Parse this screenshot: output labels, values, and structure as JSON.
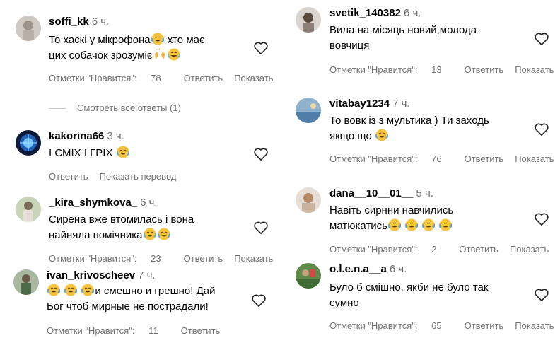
{
  "labels": {
    "likes_prefix": "Отметки \"Нравится\": ",
    "reply": "Ответить",
    "show": "Показать",
    "show_translation": "Показать перевод",
    "view_all_replies": "Смотреть все ответы (1)"
  },
  "comments_left": [
    {
      "user": "soffi_kk",
      "time": "6 ч.",
      "line1": "То хаскі у мікрофона",
      "line1_emoji": "laugh-cry",
      "line1_after": " хто має",
      "line2": "цих собачок зрозуміє",
      "line2_emojis": [
        "raised-hands",
        "laugh-cry"
      ],
      "likes": "78"
    },
    {
      "user": "kakorina66",
      "time": "3 ч.",
      "line1": "І СМІХ І ГРІХ ",
      "likes": ""
    },
    {
      "user": "_kira_shymkova_",
      "time": "6 ч.",
      "line1": "Сирена вже втомилась і вона",
      "line2": "найняла помічника",
      "likes": "23"
    },
    {
      "user": "ivan_krivoscheev",
      "time": "7 ч.",
      "line1": "и смешно и грешно! Дай",
      "line2": "Бог чтоб мирные не пострадали!",
      "likes": "11"
    }
  ],
  "comments_right": [
    {
      "user": "svetik_140382",
      "time": "6 ч.",
      "line1": "Вила на місяць новий,молода",
      "line2": "вовчиця",
      "likes": "13"
    },
    {
      "user": "vitabay1234",
      "time": "7 ч.",
      "line1": "То вовк із з мультика ) Ти заходь",
      "line2": "якщо що ",
      "likes": "76"
    },
    {
      "user": "dana__10__01__",
      "time": "5 ч.",
      "line1": "Навіть сирнни навчились",
      "line2": "матюкатись",
      "likes": "2"
    },
    {
      "user": "o.l.e.n.a__a",
      "time": "6 ч.",
      "line1": "Було б смішно, якби не було так",
      "line2": "сумно",
      "likes": "65"
    }
  ],
  "colors": {
    "muted": "#737373",
    "laugh_emoji_face": "#f5c33b",
    "laugh_emoji_tears": "#5aa8e6"
  }
}
